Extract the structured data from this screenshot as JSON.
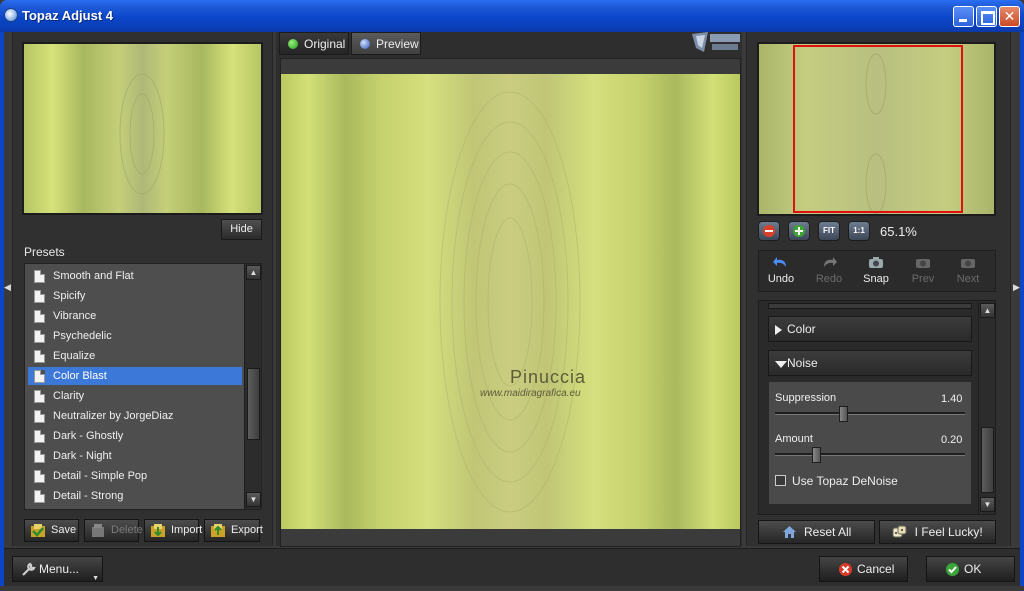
{
  "window": {
    "title": "Topaz Adjust 4",
    "controls": [
      "minimize",
      "maximize",
      "close"
    ]
  },
  "left_panel": {
    "hide_label": "Hide",
    "presets_label": "Presets",
    "presets": [
      "Smooth and Flat",
      "Spicify",
      "Vibrance",
      "Psychedelic",
      "Equalize",
      "Color Blast",
      "Clarity",
      "Neutralizer by JorgeDiaz",
      "Dark - Ghostly",
      "Dark - Night",
      "Detail - Simple Pop",
      "Detail - Strong"
    ],
    "selected_preset": "Color Blast",
    "buttons": {
      "save": "Save",
      "delete": "Delete",
      "import": "Import",
      "export": "Export"
    }
  },
  "center": {
    "tabs": {
      "original": "Original",
      "preview": "Preview"
    },
    "active_tab": "Preview",
    "watermark_name": "Pinuccia",
    "watermark_url": "www.maidiragrafica.eu"
  },
  "right_panel": {
    "zoom_level": "65.1%",
    "zoom_buttons": {
      "fit": "FIT",
      "one_to_one": "1:1"
    },
    "tools": {
      "undo": "Undo",
      "redo": "Redo",
      "snap": "Snap",
      "prev": "Prev",
      "next": "Next"
    },
    "sections": {
      "color": "Color",
      "noise": "Noise"
    },
    "noise": {
      "suppression_label": "Suppression",
      "suppression_value": "1.40",
      "amount_label": "Amount",
      "amount_value": "0.20",
      "denoise_label": "Use Topaz DeNoise",
      "denoise_checked": false
    },
    "reset_label": "Reset All",
    "lucky_label": "I Feel Lucky!"
  },
  "footer": {
    "menu_label": "Menu...",
    "cancel_label": "Cancel",
    "ok_label": "OK"
  },
  "colors": {
    "accent_selection": "#3c78d8",
    "nav_rect": "#e01010",
    "image_lime": "#c8d66a"
  }
}
